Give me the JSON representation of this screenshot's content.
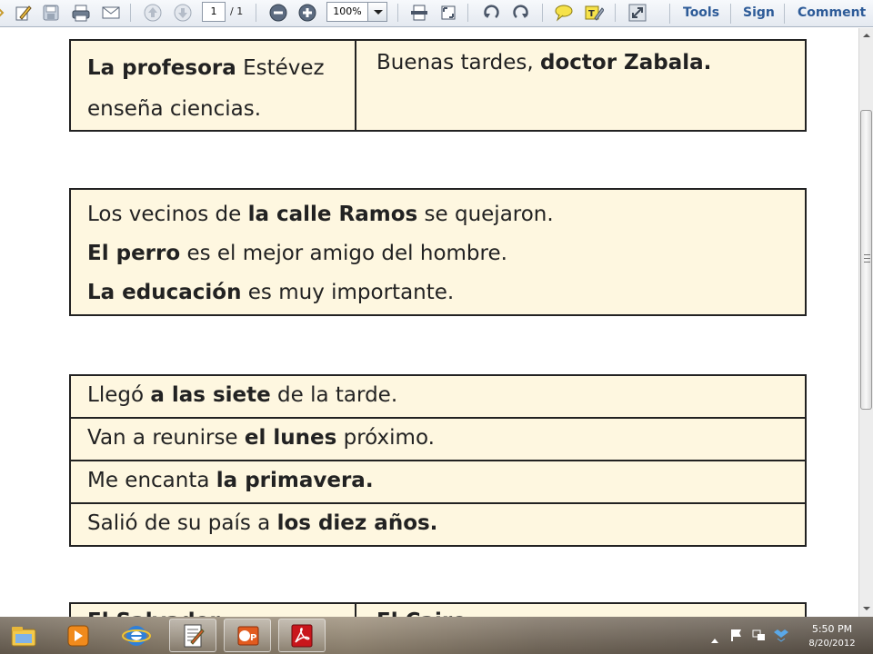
{
  "toolbar": {
    "page_current": "1",
    "page_total": "/ 1",
    "zoom": "100%",
    "tools_label": "Tools",
    "sign_label": "Sign",
    "comment_label": "Comment"
  },
  "document": {
    "box1": {
      "left": {
        "bold": "La profesora",
        "rest": " Estévez enseña ciencias."
      },
      "right": {
        "pre": "Buenas tardes, ",
        "bold": "doctor Zabala."
      }
    },
    "box2": [
      {
        "pre": "Los vecinos de ",
        "bold": "la calle Ramos",
        "post": " se quejaron."
      },
      {
        "pre": "",
        "bold": "El perro",
        "post": " es el mejor amigo del hombre."
      },
      {
        "pre": "",
        "bold": "La educación",
        "post": " es muy importante."
      }
    ],
    "box3": [
      {
        "pre": "Llegó ",
        "bold": "a las siete",
        "post": " de la tarde."
      },
      {
        "pre": "Van a reunirse ",
        "bold": "el lunes",
        "post": " próximo."
      },
      {
        "pre": "Me encanta ",
        "bold": "la primavera.",
        "post": ""
      },
      {
        "pre": "Salió de su país a ",
        "bold": "los diez años.",
        "post": ""
      }
    ],
    "box4": {
      "left": "El Salvador",
      "right": "El Cairo"
    }
  },
  "taskbar": {
    "clock_time": "5:50 PM",
    "clock_date": "8/20/2012"
  },
  "colors": {
    "box_fill": "#fef7e0",
    "toolbar_text": "#2d5b98"
  }
}
